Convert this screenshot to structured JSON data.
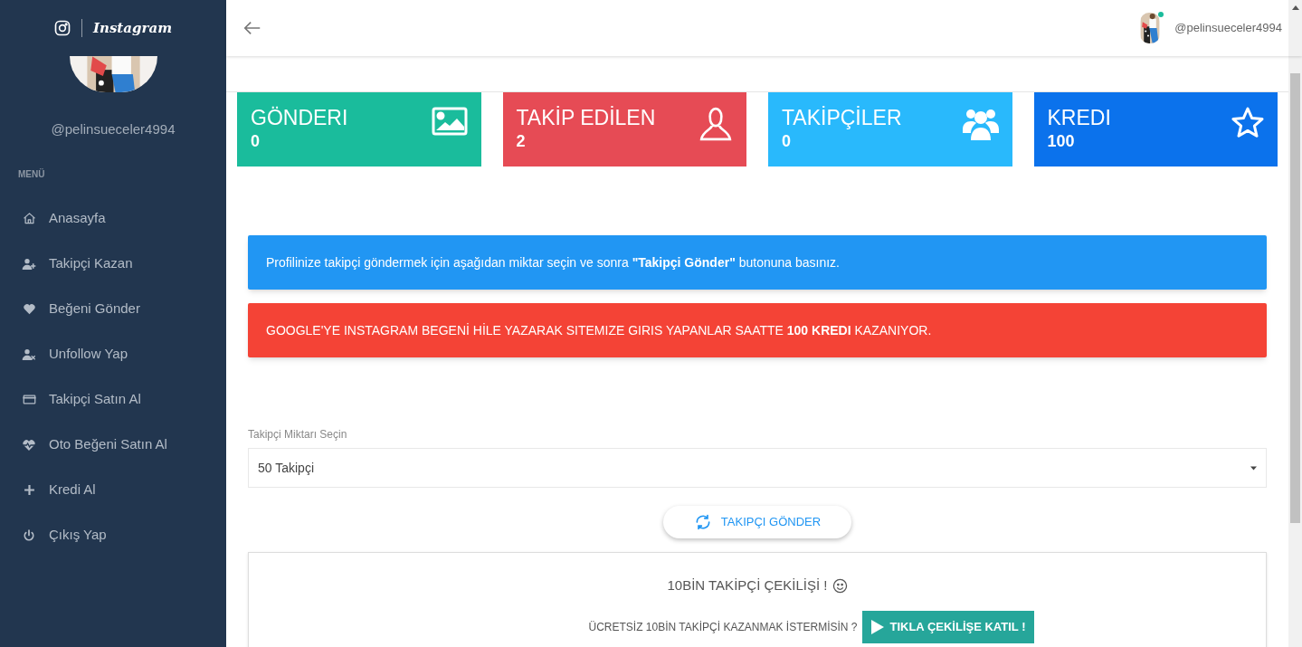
{
  "sidebar": {
    "logo_text": "Instagram",
    "username": "@pelinsueceler4994",
    "menu_heading": "MENÜ",
    "items": [
      {
        "label": "Anasayfa"
      },
      {
        "label": "Takipçi Kazan"
      },
      {
        "label": "Beğeni Gönder"
      },
      {
        "label": "Unfollow Yap"
      },
      {
        "label": "Takipçi Satın Al"
      },
      {
        "label": "Oto Beğeni Satın Al"
      },
      {
        "label": "Kredi Al"
      },
      {
        "label": "Çıkış Yap"
      }
    ]
  },
  "header": {
    "username": "@pelinsueceler4994",
    "online": true
  },
  "stats": [
    {
      "title": "GÖNDERI",
      "value": "0",
      "color": "#1abc9c"
    },
    {
      "title": "TAKİP EDİLEN",
      "value": "2",
      "color": "#e64b55"
    },
    {
      "title": "TAKİPÇİLER",
      "value": "0",
      "color": "#29b9fc"
    },
    {
      "title": "KREDI",
      "value": "100",
      "color": "#0b72ec"
    }
  ],
  "alerts": [
    {
      "kind": "info",
      "text": "Profilinize takipçi göndermek için aşağıdan miktar seçin ve sonra **\"Takipçi Gönder\"** butonuna basınız."
    },
    {
      "kind": "danger",
      "text": "GOOGLE'YE INSTAGRAM BEGENİ HİLE YAZARAK SITEMIZE GIRIS YAPANLAR SAATTE **100 KREDI** KAZANIYOR."
    }
  ],
  "form": {
    "label": "Takipçi Miktarı Seçin",
    "value": "50 Takipçi",
    "button": "TAKIPÇI GÖNDER"
  },
  "giveaway": {
    "title": "10BİN TAKİPÇİ ÇEKİLİŞİ !",
    "question": "ÜCRETSİZ 10BİN TAKİPÇİ KAZANMAK İSTERMİSİN ?",
    "button": "TIKLA ÇEKİLİŞE KATIL !"
  }
}
